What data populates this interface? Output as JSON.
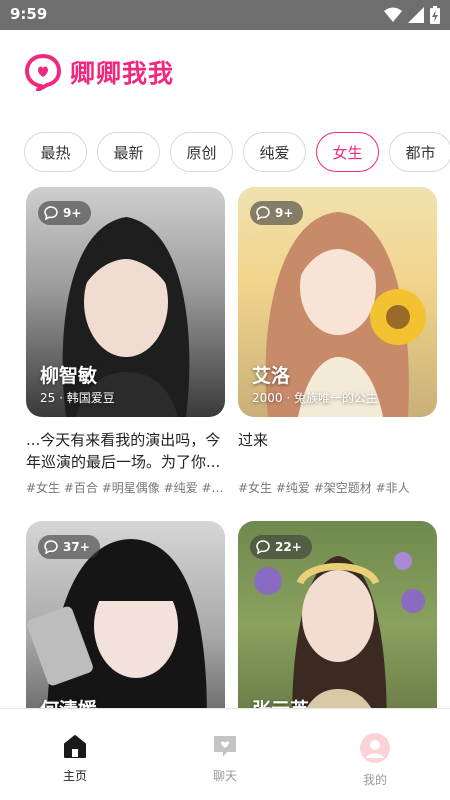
{
  "status_bar": {
    "time": "9:59"
  },
  "app": {
    "title": "卿卿我我",
    "accent": "#f0297e"
  },
  "tabs": [
    {
      "label": "最热"
    },
    {
      "label": "最新"
    },
    {
      "label": "原创"
    },
    {
      "label": "纯爱"
    },
    {
      "label": "女生",
      "active": true
    },
    {
      "label": "都市"
    }
  ],
  "cards": [
    {
      "badge": "9+",
      "name": "柳智敏",
      "sub": "25 · 韩国爱豆",
      "desc": "...今天有来看我的演出吗，今年巡演的最后一场。为了你...",
      "tags": "#女生 #百合 #明星偶像 #纯爱 #年..."
    },
    {
      "badge": "9+",
      "name": "艾洛",
      "sub": "2000 · 兔族唯一的公主",
      "desc": "过来",
      "tags": "#女生 #纯爱 #架空题材 #非人"
    },
    {
      "badge": "37+",
      "name": "何清媛",
      "sub": "",
      "desc": "",
      "tags": ""
    },
    {
      "badge": "22+",
      "name": "张元英",
      "sub": "",
      "desc": "",
      "tags": ""
    }
  ],
  "nav": [
    {
      "label": "主页",
      "icon": "home-icon",
      "active": true
    },
    {
      "label": "聊天",
      "icon": "chat-icon"
    },
    {
      "label": "我的",
      "icon": "profile-icon"
    }
  ]
}
